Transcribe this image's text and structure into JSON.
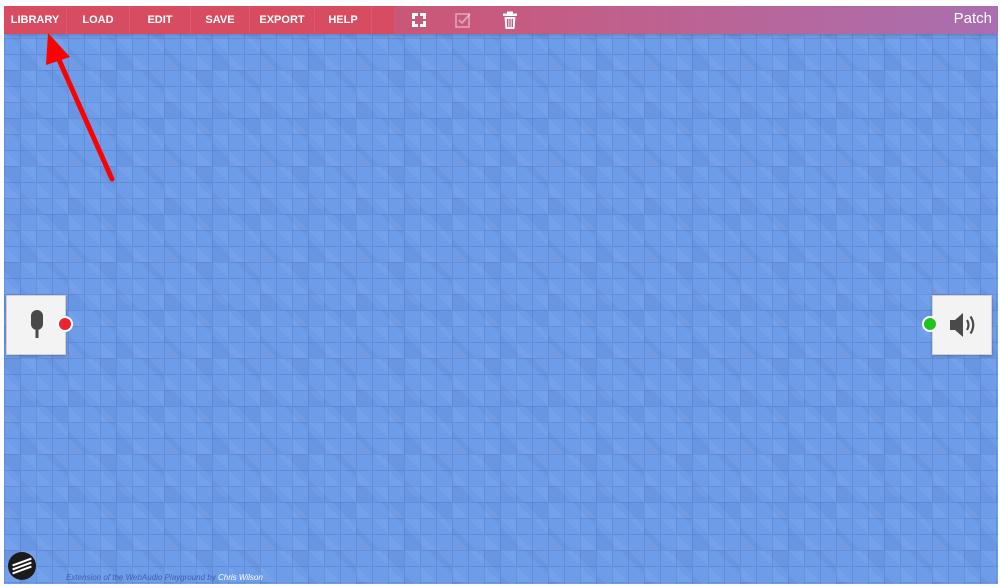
{
  "menu": {
    "library": "LIBRARY",
    "load": "LOAD",
    "edit": "EDIT",
    "save": "SAVE",
    "export": "EXPORT",
    "help": "HELP"
  },
  "toolbar": {
    "tools": [
      "fullscreen-icon",
      "checkbox-icon",
      "trash-icon"
    ]
  },
  "patch_title": "Patch",
  "nodes": {
    "input": {
      "icon": "microphone-icon",
      "port_color": "#e8262b"
    },
    "output": {
      "icon": "speaker-icon",
      "port_color": "#1cc51c"
    }
  },
  "footer": {
    "credit_prefix": "Extension of the WebAudio Playground by",
    "credit_author": "Chris Wilson"
  },
  "colors": {
    "menubar": "#d84c62",
    "canvas": "#6d9ce8",
    "annotation": "#ff0000"
  }
}
